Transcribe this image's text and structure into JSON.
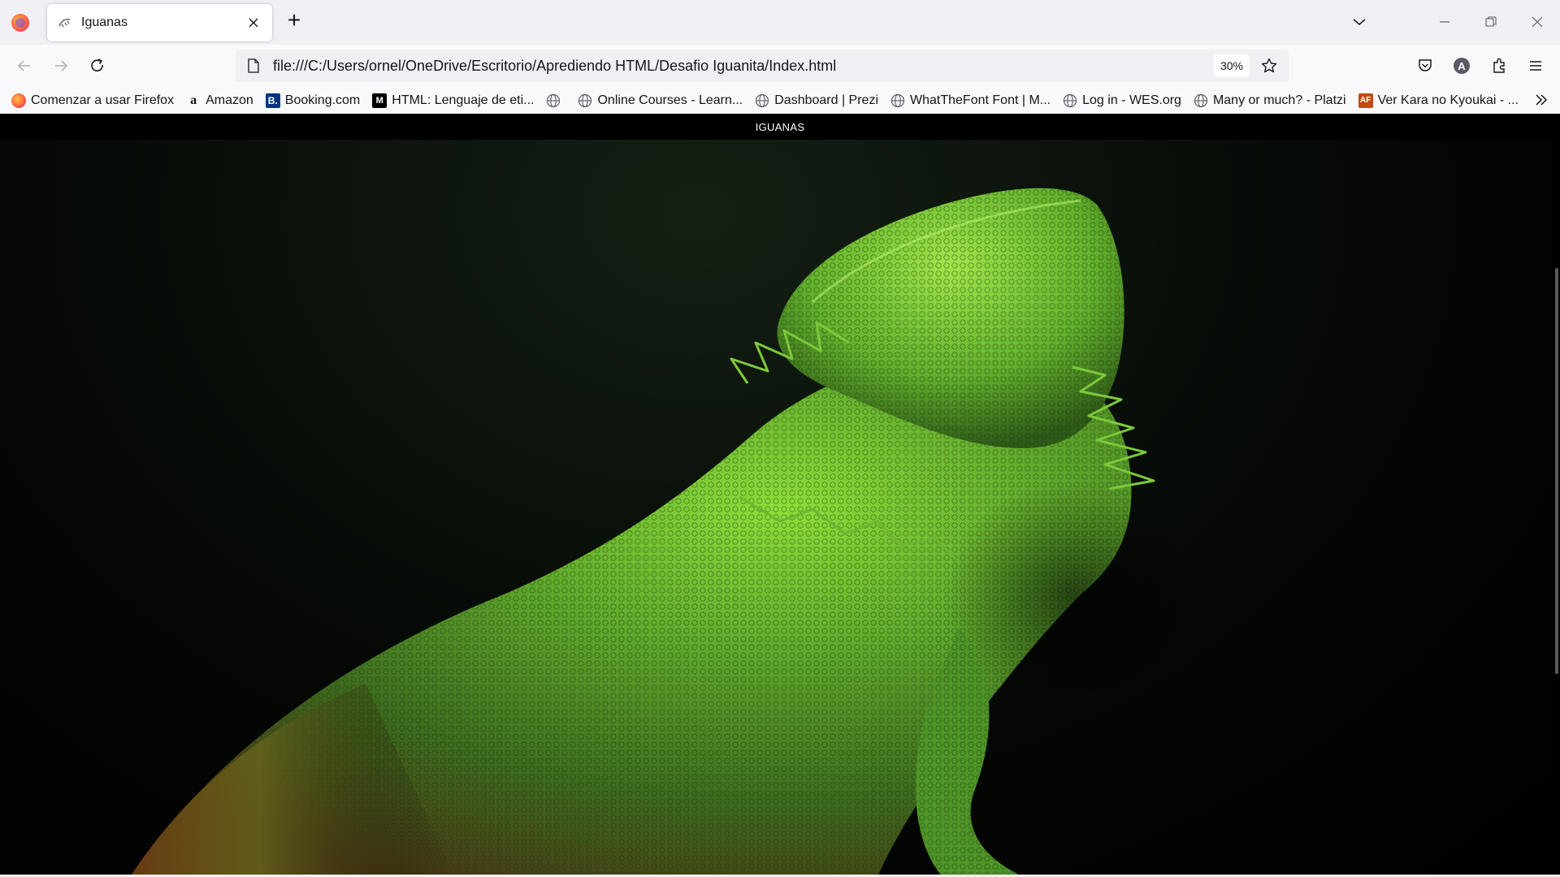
{
  "browser": {
    "tab": {
      "title": "Iguanas"
    },
    "new_tab_symbol": "+",
    "url": "file:///C:/Users/ornel/OneDrive/Escritorio/Aprediendo HTML/Desafio Iguanita/Index.html",
    "zoom": "30%",
    "account_initial": "A"
  },
  "bookmarks": [
    {
      "label": "Comenzar a usar Firefox",
      "icon": "firefox-icon"
    },
    {
      "label": "Amazon",
      "icon": "amazon-icon"
    },
    {
      "label": "Booking.com",
      "icon": "booking-icon"
    },
    {
      "label": "HTML: Lenguaje de eti...",
      "icon": "mdn-icon"
    },
    {
      "label": "",
      "icon": "globe-icon"
    },
    {
      "label": "Online Courses - Learn...",
      "icon": "globe-icon"
    },
    {
      "label": "Dashboard | Prezi",
      "icon": "globe-icon"
    },
    {
      "label": "WhatTheFont Font | M...",
      "icon": "globe-icon"
    },
    {
      "label": "Log in - WES.org",
      "icon": "globe-icon"
    },
    {
      "label": "Many or much? - Platzi",
      "icon": "globe-icon"
    },
    {
      "label": "Ver Kara no Kyoukai - ...",
      "icon": "animeflv-icon"
    }
  ],
  "page": {
    "header_title": "IGUANAS",
    "hero_image": "bearded-dragon-photo"
  },
  "colors": {
    "page_background": "#000000",
    "lizard_green": "#6fbf2a",
    "chrome": "#f9f9fb"
  }
}
